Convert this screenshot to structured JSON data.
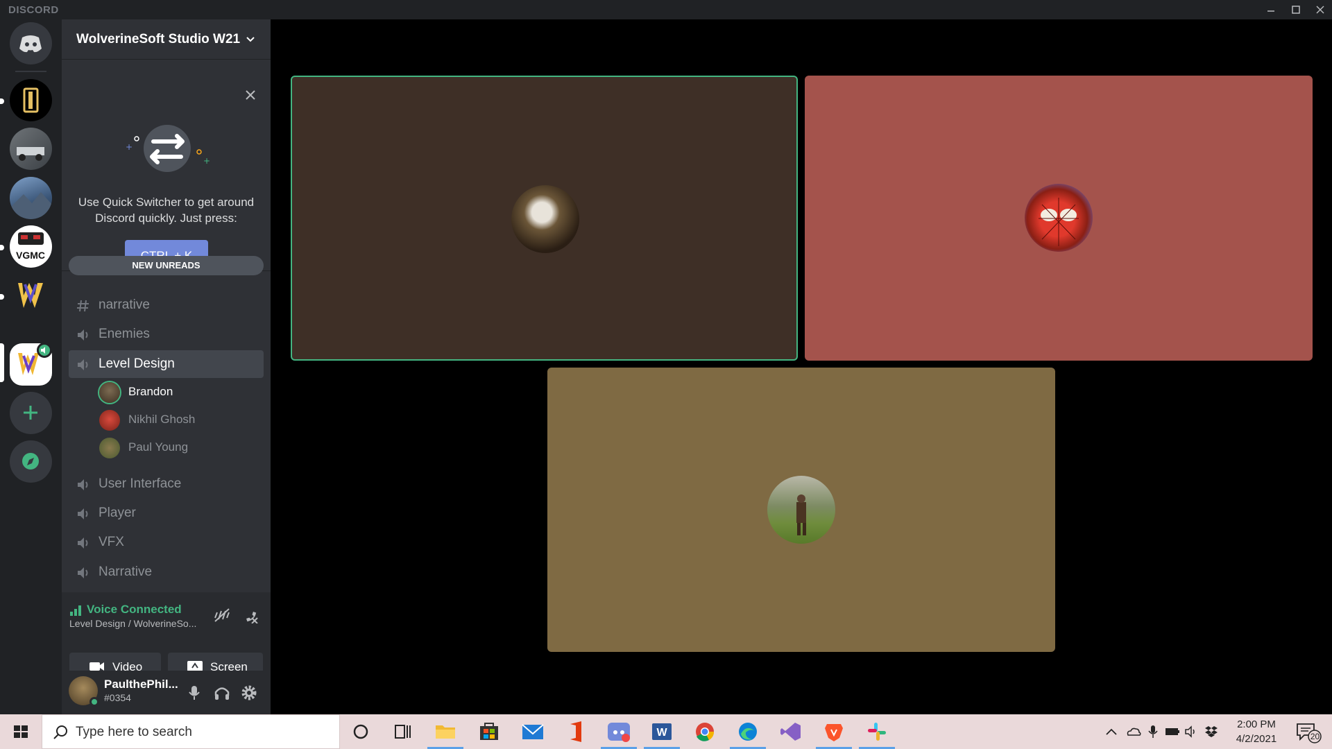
{
  "app": {
    "brand": "DISCORD"
  },
  "guild": {
    "name": "WolverineSoft Studio W21"
  },
  "tip": {
    "text": "Use Quick Switcher to get around Discord quickly. Just press:",
    "shortcut": "CTRL + K"
  },
  "channels": {
    "new_unreads": "NEW UNREADS",
    "partial_hidden": "vfx",
    "list": [
      {
        "type": "text",
        "label": "narrative"
      },
      {
        "type": "voice",
        "label": "Enemies"
      },
      {
        "type": "voice",
        "label": "Level Design"
      },
      {
        "type": "voice",
        "label": "User Interface"
      },
      {
        "type": "voice",
        "label": "Player"
      },
      {
        "type": "voice",
        "label": "VFX"
      },
      {
        "type": "voice",
        "label": "Narrative"
      }
    ],
    "voice_users": [
      {
        "name": "Brandon",
        "speaking": true
      },
      {
        "name": "Nikhil Ghosh",
        "speaking": false
      },
      {
        "name": "Paul Young",
        "speaking": false
      }
    ]
  },
  "voice": {
    "status": "Voice Connected",
    "location": "Level Design / WolverineSo...",
    "video_label": "Video",
    "screen_label": "Screen"
  },
  "user": {
    "name": "PaulthePhil...",
    "tag": "#0354"
  },
  "tiles": [
    {
      "color": "#3e2f26",
      "border": "#43b581",
      "avatar": "dog-avatar"
    },
    {
      "color": "#a4534c",
      "border": "",
      "avatar": "spiderman-avatar"
    },
    {
      "color": "#7f6a43",
      "border": "",
      "avatar": "warrior-avatar"
    }
  ],
  "taskbar": {
    "search_placeholder": "Type here to search",
    "time": "2:00 PM",
    "date": "4/2/2021",
    "notifications": "20"
  },
  "colors": {
    "accent": "#7289da",
    "green": "#43b581",
    "rail": "#202225",
    "sidebar": "#2f3136"
  }
}
